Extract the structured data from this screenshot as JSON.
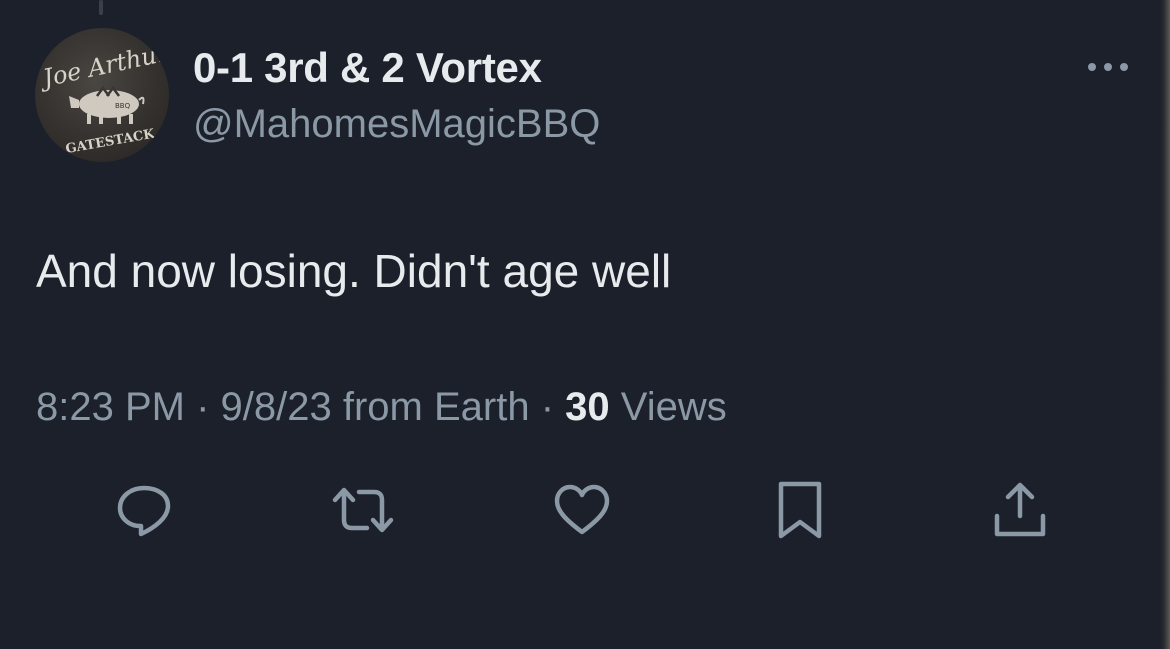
{
  "tweet": {
    "author": {
      "display_name": "0-1 3rd & 2 Vortex",
      "handle": "@MahomesMagicBBQ",
      "avatar_text_top": "Joe Arthur",
      "avatar_text_bottom": "GATESTACK",
      "avatar_text_badge": "BBQ"
    },
    "text": "And now losing. Didn't age well",
    "meta": {
      "time": "8:23 PM",
      "sep1": "·",
      "date_source": "9/8/23 from Earth",
      "sep2": "·",
      "views_count": "30",
      "views_label": "Views"
    },
    "actions": {
      "reply_icon": "reply-icon",
      "retweet_icon": "retweet-icon",
      "like_icon": "heart-icon",
      "bookmark_icon": "bookmark-icon",
      "share_icon": "share-icon"
    }
  },
  "colors": {
    "background": "#1b202a",
    "primary_text": "#e8ebee",
    "secondary_text": "#8b98a5"
  }
}
